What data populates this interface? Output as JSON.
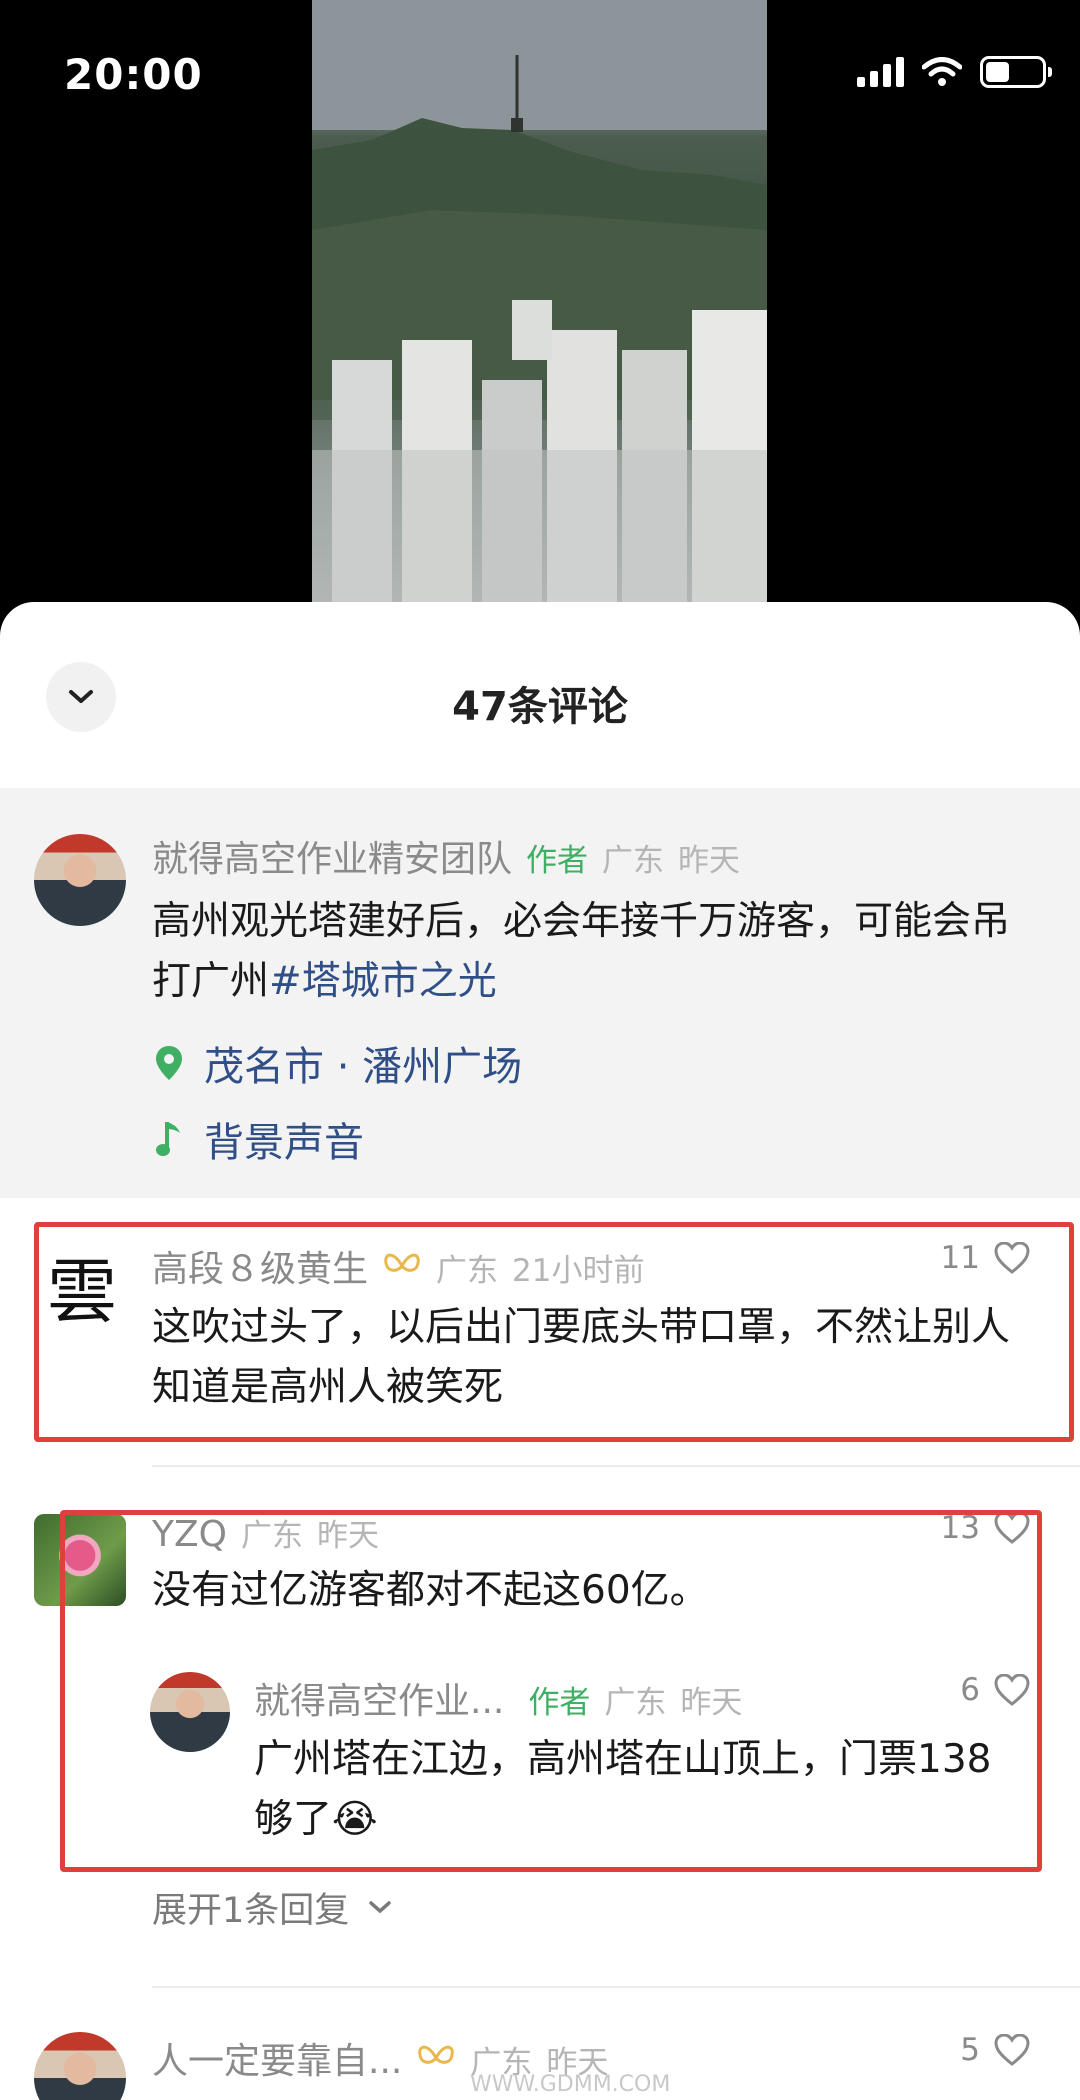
{
  "status_bar": {
    "time": "20:00"
  },
  "sheet": {
    "title": "47条评论"
  },
  "post": {
    "author": "就得高空作业精安团队",
    "author_tag": "作者",
    "location": "广东",
    "time": "昨天",
    "text_main": "高州观光塔建好后，必会年接千万游客，可能会吊打广州",
    "hashtag": "#塔城市之光",
    "place": "茂名市 · 潘州广场",
    "music": "背景声音"
  },
  "comments": [
    {
      "name": "高段８级黄生",
      "badge_icon": "butterfly-badge-icon",
      "location": "广东",
      "time": "21小时前",
      "likes": "11",
      "text": "这吹过头了，以后出门要底头带口罩，不然让别人知道是高州人被笑死"
    },
    {
      "name": "YZQ",
      "location": "广东",
      "time": "昨天",
      "likes": "13",
      "text": "没有过亿游客都对不起这60亿。",
      "reply": {
        "name": "就得高空作业...",
        "author_tag": "作者",
        "location": "广东",
        "time": "昨天",
        "likes": "6",
        "text": "广州塔在江边，高州塔在山顶上，门票138够了",
        "emoji": "😭"
      },
      "expand_label": "展开1条回复"
    },
    {
      "name": "人一定要靠自...",
      "badge_icon": "butterfly-badge-icon",
      "location": "广东",
      "time": "昨天",
      "likes": "5"
    }
  ],
  "watermark": "WWW.GDMM.COM",
  "colors": {
    "author_green": "#3fb063",
    "link_blue": "#2f4f86",
    "highlight_red": "#e0403b"
  }
}
